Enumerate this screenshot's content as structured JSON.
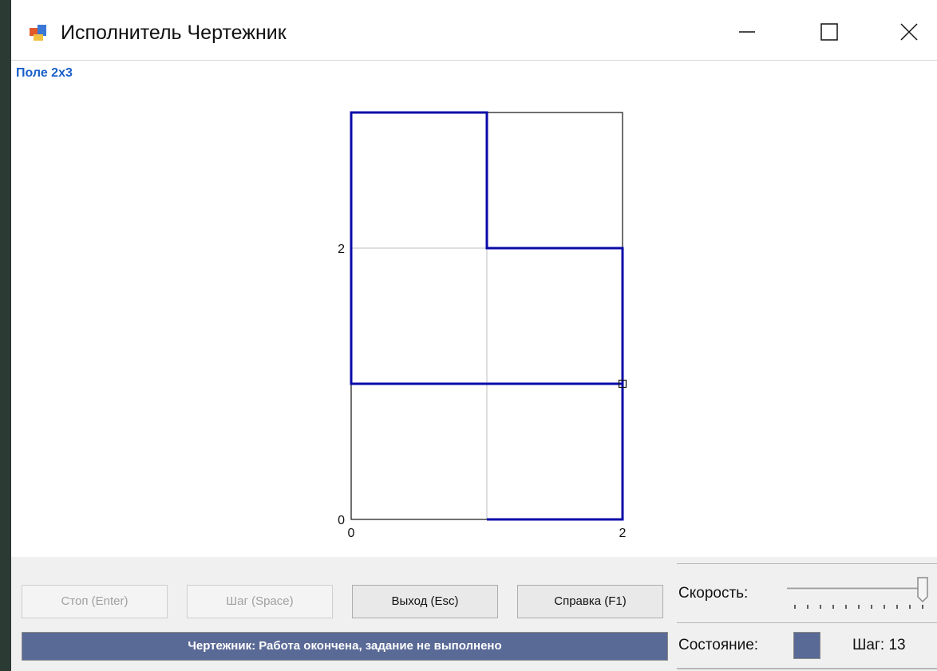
{
  "window": {
    "title": "Исполнитель Чертежник",
    "controls": [
      "minimize",
      "maximize",
      "close"
    ]
  },
  "menu": {
    "items": [
      "Поле 2x3"
    ]
  },
  "field": {
    "x_ticks": [
      "0",
      "2"
    ],
    "y_ticks": [
      "0",
      "2"
    ],
    "grid_cols": 2,
    "grid_rows": 3,
    "drawn_path": [
      [
        1,
        0
      ],
      [
        2,
        0
      ],
      [
        2,
        1
      ],
      [
        0,
        1
      ],
      [
        0,
        3
      ],
      [
        1,
        3
      ],
      [
        1,
        2
      ],
      [
        2,
        2
      ],
      [
        2,
        1
      ]
    ],
    "pen_position": [
      2,
      1
    ],
    "colors": {
      "path": "#0a0aa8",
      "grid": "#bdbdbd",
      "border": "#111111"
    }
  },
  "buttons": {
    "stop": "Стоп (Enter)",
    "step": "Шаг (Space)",
    "exit": "Выход (Esc)",
    "help": "Справка (F1)"
  },
  "status": {
    "message": "Чертежник: Работа окончена, задание не выполнено",
    "color": "#5a6a96"
  },
  "speed": {
    "label": "Скорость:",
    "level": 1.0
  },
  "state": {
    "label": "Состояние:",
    "color": "#5a6a96",
    "step_text": "Шаг: 13"
  }
}
